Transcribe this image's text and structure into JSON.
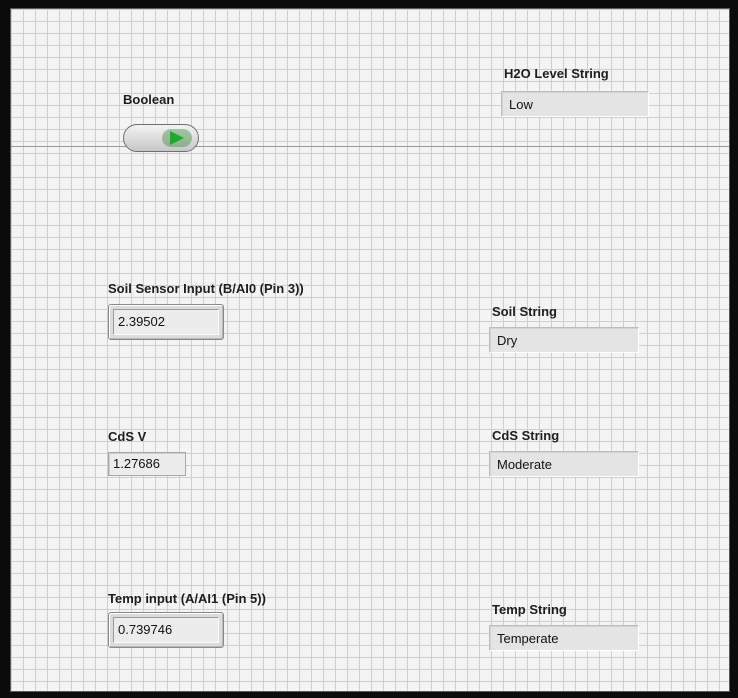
{
  "boolean": {
    "label": "Boolean",
    "state": "on",
    "led_color": "#22a830"
  },
  "h2o": {
    "label": "H2O Level String",
    "value": "Low"
  },
  "soil_input": {
    "label": "Soil Sensor Input (B/AI0 (Pin 3))",
    "value": "2.39502"
  },
  "soil_string": {
    "label": "Soil String",
    "value": "Dry"
  },
  "cds_v": {
    "label": "CdS V",
    "value": "1.27686"
  },
  "cds_string": {
    "label": "CdS String",
    "value": "Moderate"
  },
  "temp_input": {
    "label": "Temp input (A/AI1 (Pin 5))",
    "value": "0.739746"
  },
  "temp_string": {
    "label": "Temp String",
    "value": "Temperate"
  }
}
